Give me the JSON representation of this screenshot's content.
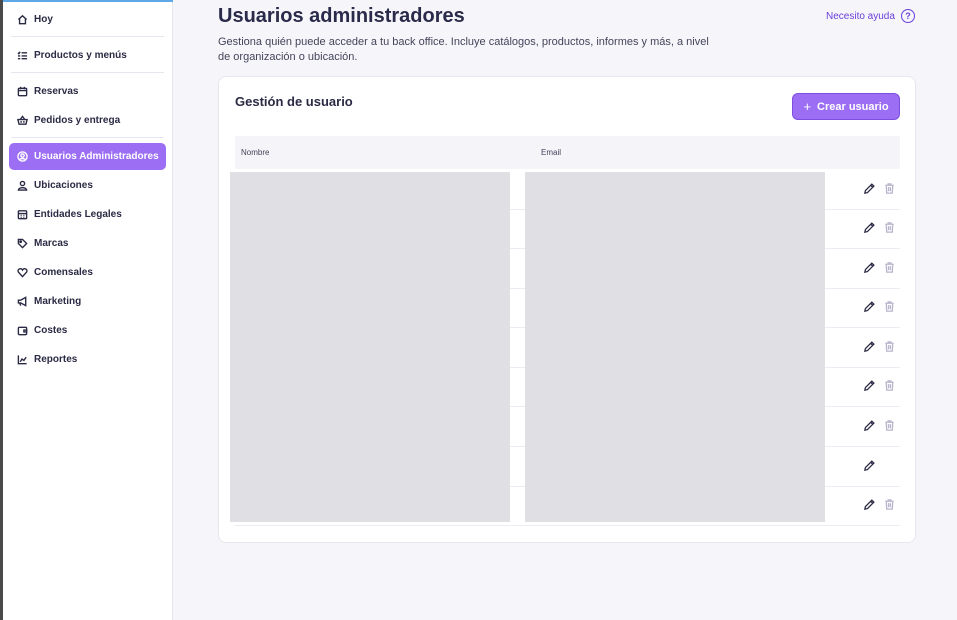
{
  "sidebar": {
    "items": [
      {
        "label": "Hoy",
        "icon": "home-icon"
      },
      {
        "label": "Productos y menús",
        "icon": "list-icon"
      },
      {
        "label": "Reservas",
        "icon": "calendar-icon"
      },
      {
        "label": "Pedidos y entrega",
        "icon": "basket-icon"
      },
      {
        "label": "Usuarios Administradores",
        "icon": "user-circle-icon",
        "active": true
      },
      {
        "label": "Ubicaciones",
        "icon": "user-location-icon"
      },
      {
        "label": "Entidades Legales",
        "icon": "building-icon"
      },
      {
        "label": "Marcas",
        "icon": "tag-icon"
      },
      {
        "label": "Comensales",
        "icon": "heart-icon"
      },
      {
        "label": "Marketing",
        "icon": "megaphone-icon"
      },
      {
        "label": "Costes",
        "icon": "wallet-icon"
      },
      {
        "label": "Reportes",
        "icon": "chart-icon"
      }
    ]
  },
  "header": {
    "title": "Usuarios administradores",
    "description": "Gestiona quién puede acceder a tu back office. Incluye catálogos, productos, informes y más, a nivel de organización o ubicación.",
    "help_label": "Necesito ayuda",
    "help_icon_glyph": "?"
  },
  "card": {
    "title": "Gestión de usuario",
    "create_button_label": "Crear usuario",
    "create_button_glyph": "+",
    "columns": {
      "name": "Nombre",
      "email": "Email"
    },
    "rows": [
      {
        "deletable": true
      },
      {
        "deletable": true
      },
      {
        "deletable": true
      },
      {
        "deletable": true
      },
      {
        "deletable": true
      },
      {
        "deletable": true
      },
      {
        "deletable": true
      },
      {
        "deletable": false
      },
      {
        "deletable": true
      }
    ]
  },
  "colors": {
    "accent": "#9b6ef3",
    "help_link": "#6a3fd8",
    "redaction": "#e0dfe4"
  }
}
